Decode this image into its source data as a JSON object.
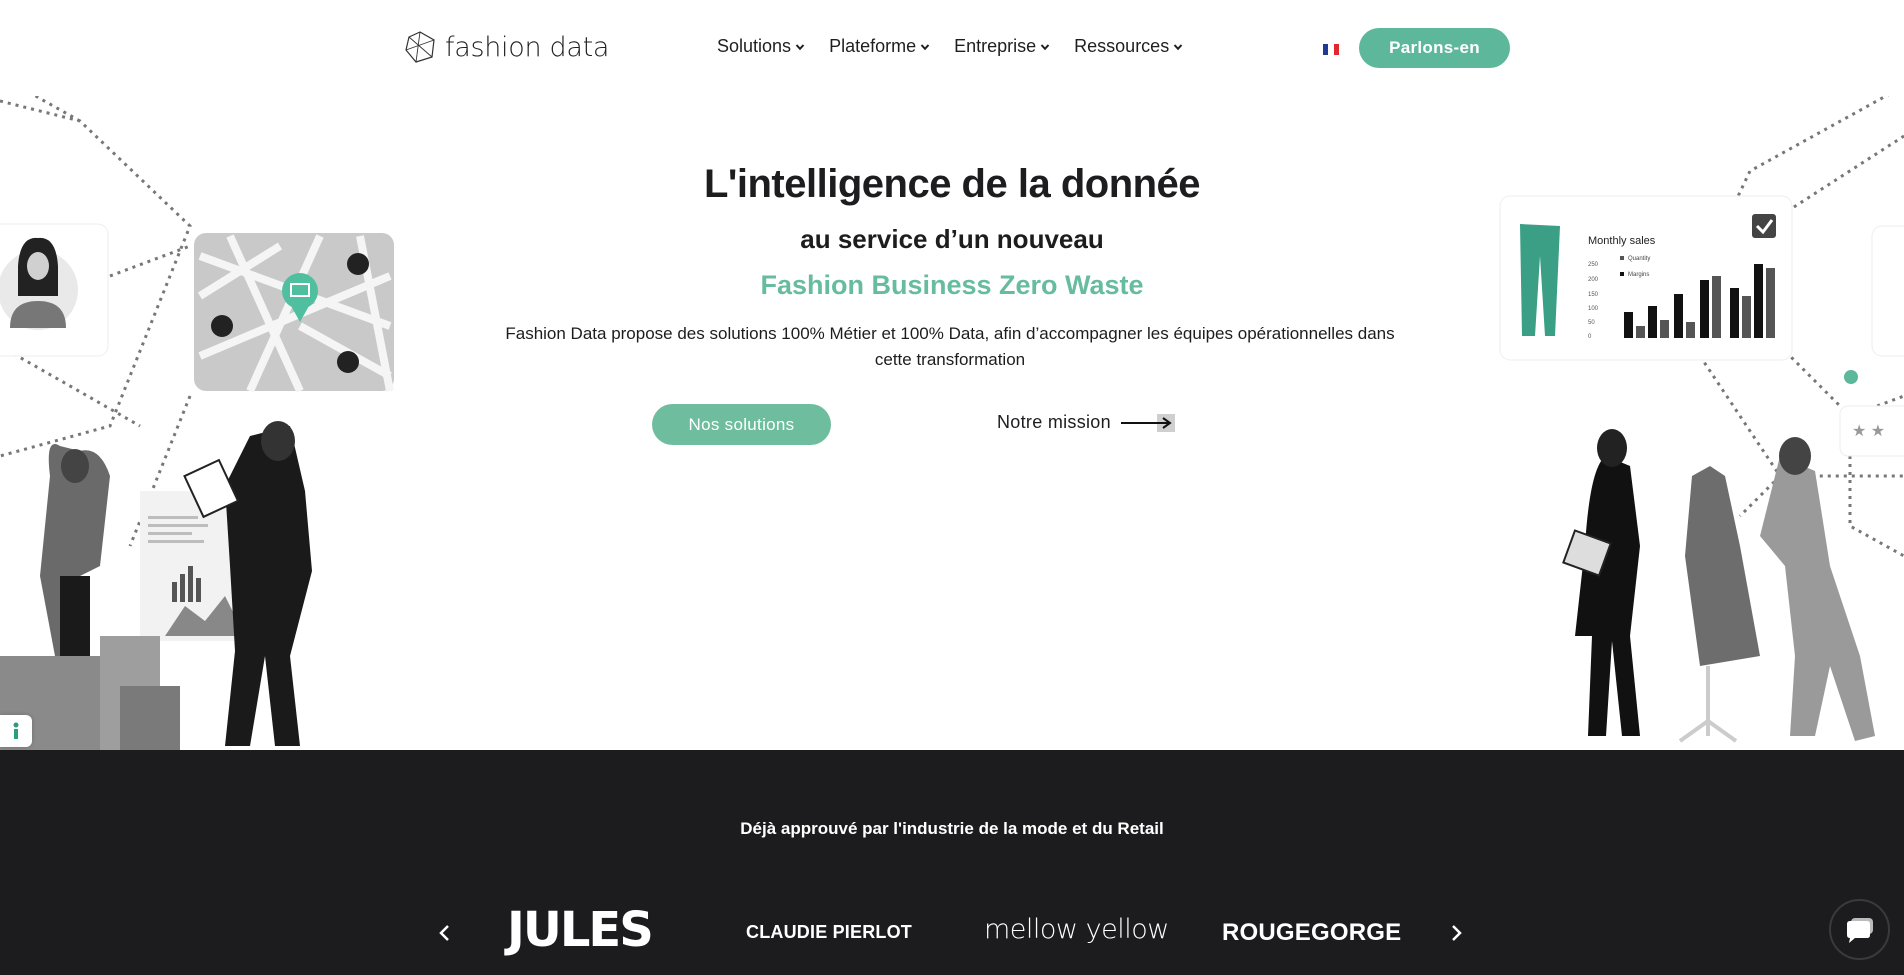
{
  "header": {
    "logo_text": "fashion data",
    "nav": [
      {
        "label": "Solutions"
      },
      {
        "label": "Plateforme"
      },
      {
        "label": "Entreprise"
      },
      {
        "label": "Ressources"
      }
    ],
    "language": "fr",
    "cta_label": "Parlons-en"
  },
  "hero": {
    "title": "L'intelligence de la donnée",
    "subtitle": "au service d’un nouveau",
    "accent": "Fashion Business Zero Waste",
    "description": "Fashion Data propose des solutions 100% Métier et 100% Data, afin d’accompagner les équipes opérationnelles dans cette transformation",
    "primary_button": "Nos solutions",
    "secondary_link": "Notre mission"
  },
  "illustration": {
    "chart_card_title": "Monthly sales",
    "chart_legend": [
      "Quantity",
      "Margins"
    ],
    "chart_ticks": [
      "250",
      "200",
      "150",
      "100",
      "50",
      "0"
    ]
  },
  "trusted": {
    "title": "Déjà approuvé par l'industrie de la mode et du Retail",
    "brands": [
      "JULES",
      "CLAUDIE PIERLOT",
      "mellow yellow",
      "ROUGEGORGE"
    ]
  },
  "colors": {
    "accent": "#5db89b",
    "dark": "#1c1c1e"
  }
}
